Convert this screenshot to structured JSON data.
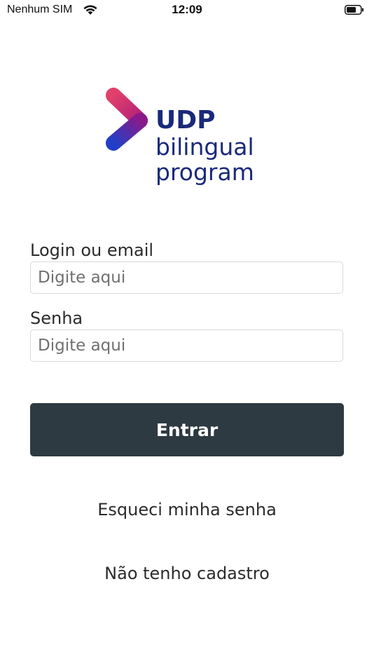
{
  "status_bar": {
    "carrier": "Nenhum SIM",
    "time": "12:09",
    "wifi_icon": "wifi-icon",
    "battery_icon": "battery-icon"
  },
  "logo": {
    "brand": "UDP",
    "line1": "bilingual",
    "line2": "program",
    "colors": {
      "text": "#1a2a7a",
      "mark_top": "#d6336c",
      "mark_bottom": "#2a3ac0"
    }
  },
  "form": {
    "login": {
      "label": "Login ou email",
      "placeholder": "Digite aqui",
      "value": ""
    },
    "password": {
      "label": "Senha",
      "placeholder": "Digite aqui",
      "value": ""
    },
    "submit_label": "Entrar",
    "submit_color": "#2e3a42"
  },
  "links": {
    "forgot_password": "Esqueci minha senha",
    "no_account": "Não tenho cadastro"
  }
}
